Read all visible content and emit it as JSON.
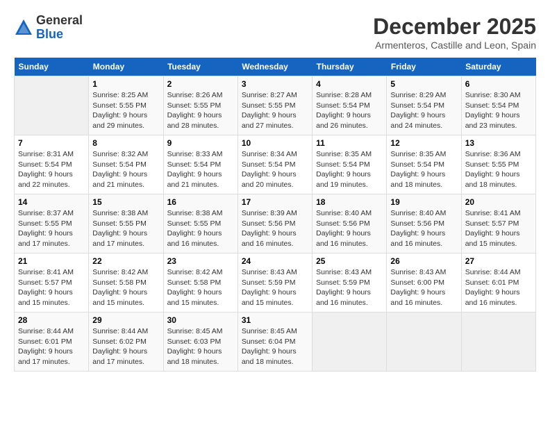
{
  "logo": {
    "general": "General",
    "blue": "Blue"
  },
  "header": {
    "month": "December 2025",
    "location": "Armenteros, Castille and Leon, Spain"
  },
  "weekdays": [
    "Sunday",
    "Monday",
    "Tuesday",
    "Wednesday",
    "Thursday",
    "Friday",
    "Saturday"
  ],
  "weeks": [
    [
      {
        "day": "",
        "sunrise": "",
        "sunset": "",
        "daylight": ""
      },
      {
        "day": "1",
        "sunrise": "8:25 AM",
        "sunset": "5:55 PM",
        "daylight": "9 hours and 29 minutes."
      },
      {
        "day": "2",
        "sunrise": "8:26 AM",
        "sunset": "5:55 PM",
        "daylight": "9 hours and 28 minutes."
      },
      {
        "day": "3",
        "sunrise": "8:27 AM",
        "sunset": "5:55 PM",
        "daylight": "9 hours and 27 minutes."
      },
      {
        "day": "4",
        "sunrise": "8:28 AM",
        "sunset": "5:54 PM",
        "daylight": "9 hours and 26 minutes."
      },
      {
        "day": "5",
        "sunrise": "8:29 AM",
        "sunset": "5:54 PM",
        "daylight": "9 hours and 24 minutes."
      },
      {
        "day": "6",
        "sunrise": "8:30 AM",
        "sunset": "5:54 PM",
        "daylight": "9 hours and 23 minutes."
      }
    ],
    [
      {
        "day": "7",
        "sunrise": "8:31 AM",
        "sunset": "5:54 PM",
        "daylight": "9 hours and 22 minutes."
      },
      {
        "day": "8",
        "sunrise": "8:32 AM",
        "sunset": "5:54 PM",
        "daylight": "9 hours and 21 minutes."
      },
      {
        "day": "9",
        "sunrise": "8:33 AM",
        "sunset": "5:54 PM",
        "daylight": "9 hours and 21 minutes."
      },
      {
        "day": "10",
        "sunrise": "8:34 AM",
        "sunset": "5:54 PM",
        "daylight": "9 hours and 20 minutes."
      },
      {
        "day": "11",
        "sunrise": "8:35 AM",
        "sunset": "5:54 PM",
        "daylight": "9 hours and 19 minutes."
      },
      {
        "day": "12",
        "sunrise": "8:35 AM",
        "sunset": "5:54 PM",
        "daylight": "9 hours and 18 minutes."
      },
      {
        "day": "13",
        "sunrise": "8:36 AM",
        "sunset": "5:55 PM",
        "daylight": "9 hours and 18 minutes."
      }
    ],
    [
      {
        "day": "14",
        "sunrise": "8:37 AM",
        "sunset": "5:55 PM",
        "daylight": "9 hours and 17 minutes."
      },
      {
        "day": "15",
        "sunrise": "8:38 AM",
        "sunset": "5:55 PM",
        "daylight": "9 hours and 17 minutes."
      },
      {
        "day": "16",
        "sunrise": "8:38 AM",
        "sunset": "5:55 PM",
        "daylight": "9 hours and 16 minutes."
      },
      {
        "day": "17",
        "sunrise": "8:39 AM",
        "sunset": "5:56 PM",
        "daylight": "9 hours and 16 minutes."
      },
      {
        "day": "18",
        "sunrise": "8:40 AM",
        "sunset": "5:56 PM",
        "daylight": "9 hours and 16 minutes."
      },
      {
        "day": "19",
        "sunrise": "8:40 AM",
        "sunset": "5:56 PM",
        "daylight": "9 hours and 16 minutes."
      },
      {
        "day": "20",
        "sunrise": "8:41 AM",
        "sunset": "5:57 PM",
        "daylight": "9 hours and 15 minutes."
      }
    ],
    [
      {
        "day": "21",
        "sunrise": "8:41 AM",
        "sunset": "5:57 PM",
        "daylight": "9 hours and 15 minutes."
      },
      {
        "day": "22",
        "sunrise": "8:42 AM",
        "sunset": "5:58 PM",
        "daylight": "9 hours and 15 minutes."
      },
      {
        "day": "23",
        "sunrise": "8:42 AM",
        "sunset": "5:58 PM",
        "daylight": "9 hours and 15 minutes."
      },
      {
        "day": "24",
        "sunrise": "8:43 AM",
        "sunset": "5:59 PM",
        "daylight": "9 hours and 15 minutes."
      },
      {
        "day": "25",
        "sunrise": "8:43 AM",
        "sunset": "5:59 PM",
        "daylight": "9 hours and 16 minutes."
      },
      {
        "day": "26",
        "sunrise": "8:43 AM",
        "sunset": "6:00 PM",
        "daylight": "9 hours and 16 minutes."
      },
      {
        "day": "27",
        "sunrise": "8:44 AM",
        "sunset": "6:01 PM",
        "daylight": "9 hours and 16 minutes."
      }
    ],
    [
      {
        "day": "28",
        "sunrise": "8:44 AM",
        "sunset": "6:01 PM",
        "daylight": "9 hours and 17 minutes."
      },
      {
        "day": "29",
        "sunrise": "8:44 AM",
        "sunset": "6:02 PM",
        "daylight": "9 hours and 17 minutes."
      },
      {
        "day": "30",
        "sunrise": "8:45 AM",
        "sunset": "6:03 PM",
        "daylight": "9 hours and 18 minutes."
      },
      {
        "day": "31",
        "sunrise": "8:45 AM",
        "sunset": "6:04 PM",
        "daylight": "9 hours and 18 minutes."
      },
      {
        "day": "",
        "sunrise": "",
        "sunset": "",
        "daylight": ""
      },
      {
        "day": "",
        "sunrise": "",
        "sunset": "",
        "daylight": ""
      },
      {
        "day": "",
        "sunrise": "",
        "sunset": "",
        "daylight": ""
      }
    ]
  ],
  "labels": {
    "sunrise_prefix": "Sunrise: ",
    "sunset_prefix": "Sunset: ",
    "daylight_prefix": "Daylight: "
  }
}
